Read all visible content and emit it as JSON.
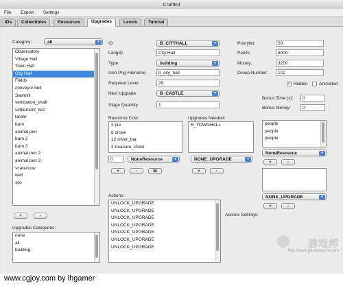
{
  "window": {
    "title": "CraftEd"
  },
  "menu": [
    "File",
    "Export",
    "Settings"
  ],
  "tabs": [
    "IDs",
    "Collectibles",
    "Resources",
    "Upgrades",
    "Levels",
    "Tutorial"
  ],
  "active_tab": "Upgrades",
  "category": {
    "label": "Category:",
    "selected": "all",
    "items": [
      "Observatory",
      "Village Hall",
      "Town Hall",
      "City Hall",
      "Fields",
      "conveyor belt",
      "Sawmill",
      "ventilation_shaft",
      "settlement_lvl2",
      "larder",
      "barn",
      "animal pen",
      "barn 2",
      "barn 3",
      "animal pen 2",
      "animal pen 3",
      "scarecrow",
      "well",
      "silo"
    ],
    "selected_item": "City Hall",
    "add": "+",
    "remove": "-"
  },
  "upgrade_categories": {
    "label": "Upgrades Categories:",
    "items": [
      "none",
      "all",
      "building"
    ]
  },
  "form": {
    "id_label": "ID",
    "id_value": "B_CITYHALL",
    "langid_label": "LangID",
    "langid_value": "City Hall",
    "type_label": "Type",
    "type_value": "building",
    "icon_label": "Icon Png Filename",
    "icon_value": "b_city_hall",
    "reqlevel_label": "Required Level",
    "reqlevel_value": "20",
    "next_label": "Next Upgrade",
    "next_value": "B_CASTLE",
    "stage_label": "Stage Quantity",
    "stage_value": "1"
  },
  "right_form": {
    "priority_label": "Priorytet:",
    "priority_value": "20",
    "points_label": "Points",
    "points_value": "8000",
    "money_label": "Money:",
    "money_value": "3200",
    "group_label": "Group Number:",
    "group_value": "102",
    "hidden_label": "Hidden",
    "hidden_checked": true,
    "animated_label": "Animated",
    "animated_checked": false,
    "bonus_time_label": "Bonus Time (s):",
    "bonus_time_value": "0",
    "bonus_money_label": "Bonus Money:",
    "bonus_money_value": "0"
  },
  "resource_cost": {
    "label": "Resource Cost:",
    "items": [
      "2 pie",
      "8 drove",
      "12 silver_bar",
      "2 treasure_chest"
    ],
    "qty_value": "0",
    "resource_select": "NoneResource",
    "add": "+",
    "remove": "-",
    "modify": "M"
  },
  "upgrades_needed": {
    "label": "Upgrades Needed:",
    "items": [
      "B_TOWNHALL"
    ],
    "select": "NONE_UPGRADE",
    "add": "+",
    "remove": "-"
  },
  "people_list": {
    "items": [
      "people",
      "people",
      "people"
    ],
    "select": "NoneResource",
    "add": "+",
    "remove": "-"
  },
  "upgrade_list2": {
    "items": [],
    "select": "NONE_UPGRADE",
    "add": "+",
    "remove": "-"
  },
  "actions": {
    "label": "Actions:",
    "items": [
      "UNLOCK_UPGRADE",
      "UNLOCK_UPGRADE",
      "UNLOCK_UPGRADE",
      "UNLOCK_UPGRADE",
      "UNLOCK_UPGRADE",
      "UNLOCK_UPGRADE",
      "UNLOCK_UPGRADE"
    ],
    "settings_label": "Actions Settings:"
  },
  "watermark": {
    "cn": "游戏邦",
    "url": "http://www.gamerboom.com"
  },
  "credit": "www.cgjoy.com by lhgamer",
  "colors": {
    "selection": "#3d87d9",
    "dropdown_arrow": "#4a7fd6"
  }
}
